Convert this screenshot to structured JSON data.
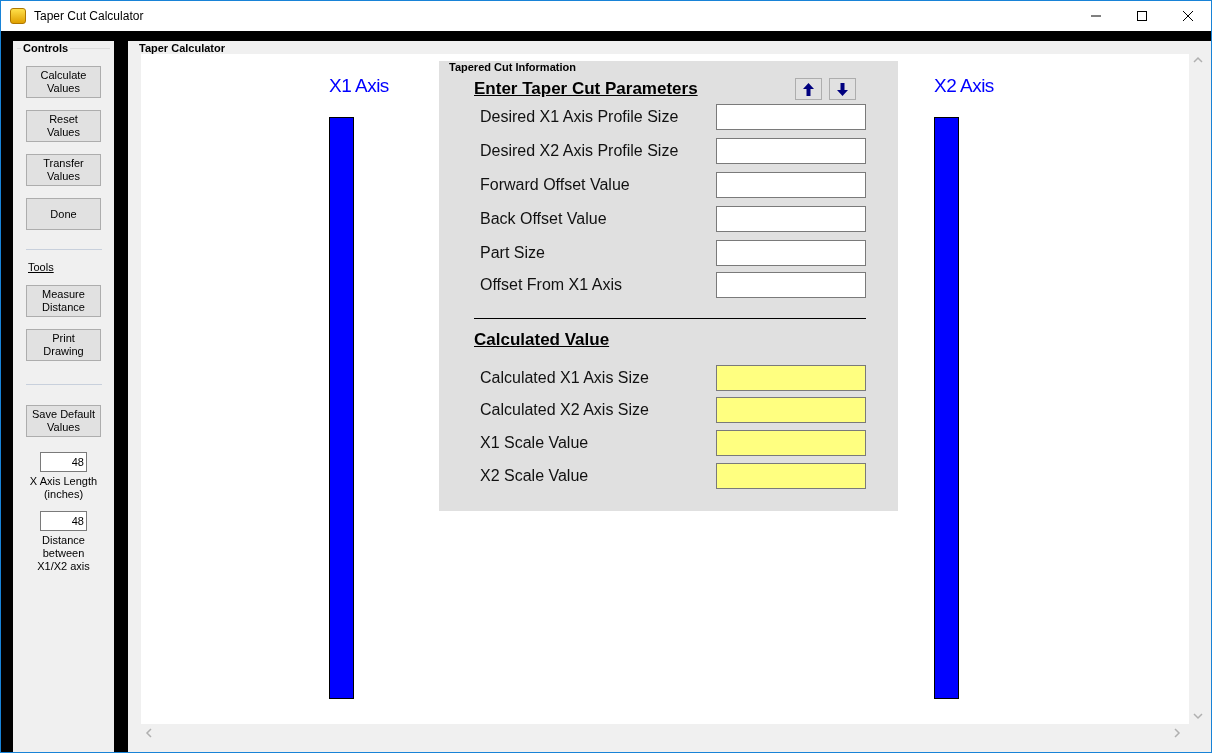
{
  "window": {
    "title": "Taper Cut Calculator"
  },
  "controls": {
    "title": "Controls",
    "buttons": [
      "Calculate Values",
      "Reset Values",
      "Transfer Values",
      "Done"
    ],
    "tools_label": "Tools",
    "tool_buttons": [
      "Measure Distance",
      "Print Drawing"
    ],
    "save_button": "Save Default Values",
    "fields": [
      {
        "value": "48",
        "label": "X Axis Length (inches)"
      },
      {
        "value": "48",
        "label": "Distance between X1/X2 axis"
      }
    ]
  },
  "calculator": {
    "title": "Taper Calculator",
    "axes": [
      {
        "label": "X1 Axis"
      },
      {
        "label": "X2 Axis"
      }
    ],
    "info": {
      "title": "Tapered Cut Information",
      "heading": "Enter Taper Cut Parameters",
      "parameters": [
        {
          "label": "Desired X1 Axis Profile Size"
        },
        {
          "label": "Desired X2 Axis Profile Size"
        },
        {
          "label": "Forward Offset Value"
        },
        {
          "label": "Back Offset Value"
        },
        {
          "label": "Part Size"
        },
        {
          "label": "Offset From X1 Axis"
        }
      ],
      "result_heading": "Calculated Value",
      "results": [
        {
          "label": "Calculated X1 Axis Size"
        },
        {
          "label": "Calculated X2 Axis Size"
        },
        {
          "label": "X1 Scale Value"
        },
        {
          "label": "X2 Scale Value"
        }
      ]
    }
  }
}
